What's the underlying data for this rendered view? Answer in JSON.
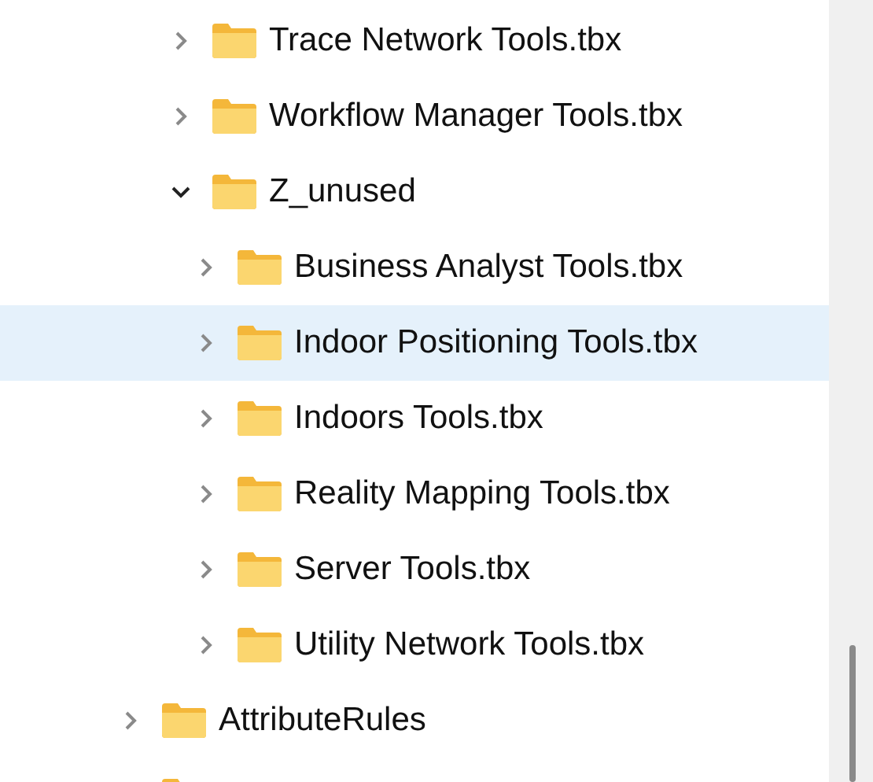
{
  "tree": {
    "open_folder_children": [
      {
        "label": "Trace Network Tools.tbx",
        "expanded": false,
        "selected": false
      },
      {
        "label": "Workflow Manager Tools.tbx",
        "expanded": false,
        "selected": false
      },
      {
        "label": "Z_unused",
        "expanded": true,
        "selected": false,
        "children": [
          {
            "label": "Business Analyst Tools.tbx",
            "expanded": false,
            "selected": false
          },
          {
            "label": "Indoor Positioning Tools.tbx",
            "expanded": false,
            "selected": true
          },
          {
            "label": "Indoors Tools.tbx",
            "expanded": false,
            "selected": false
          },
          {
            "label": "Reality Mapping Tools.tbx",
            "expanded": false,
            "selected": false
          },
          {
            "label": "Server Tools.tbx",
            "expanded": false,
            "selected": false
          },
          {
            "label": "Utility Network Tools.tbx",
            "expanded": false,
            "selected": false
          }
        ]
      }
    ],
    "siblings": [
      {
        "label": "AttributeRules",
        "expanded": false,
        "selected": false
      },
      {
        "selected": false
      }
    ]
  }
}
